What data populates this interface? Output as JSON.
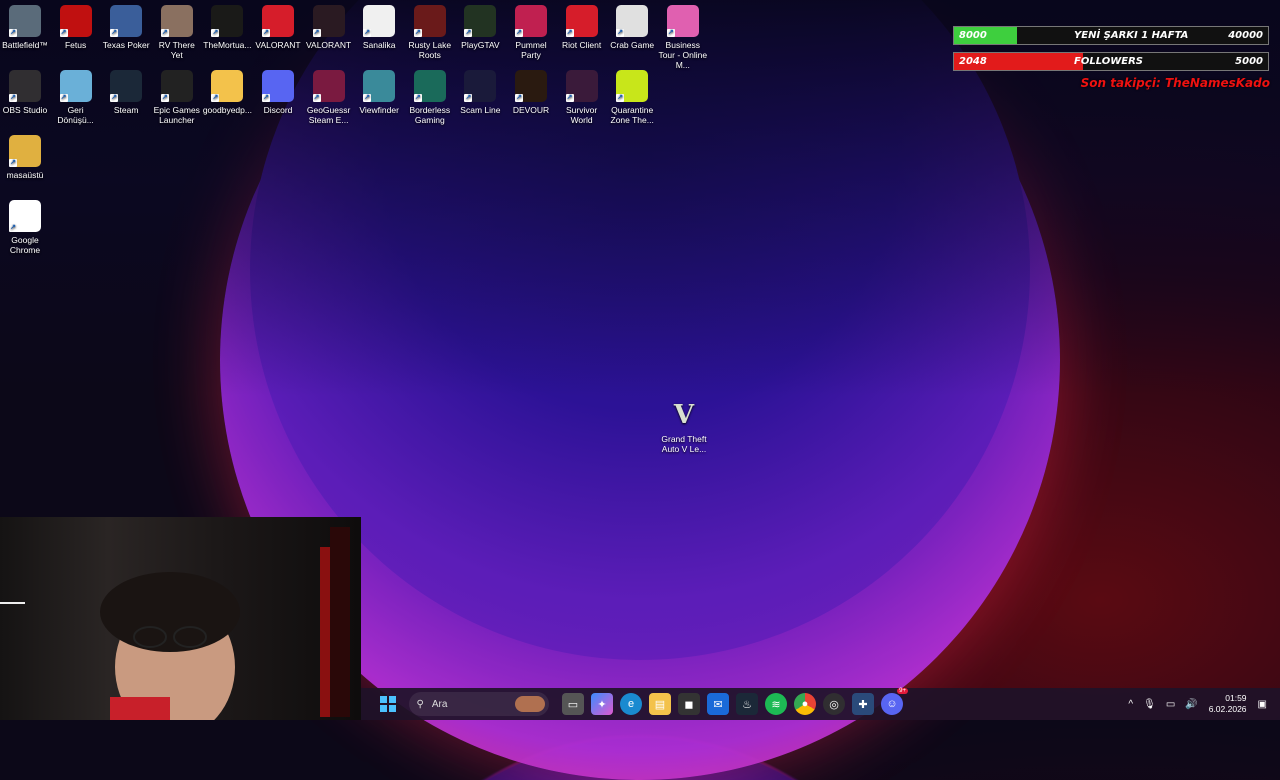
{
  "desktop_icons_row1": [
    {
      "label": "Battlefield™",
      "icon": "battlefield-icon",
      "color": "#5a6b7a"
    },
    {
      "label": "Fetus",
      "icon": "red-creature-icon",
      "color": "#c01010"
    },
    {
      "label": "Texas Poker",
      "icon": "poker-icon",
      "color": "#3a5e9a"
    },
    {
      "label": "RV There Yet",
      "icon": "rv-icon",
      "color": "#8a7060"
    },
    {
      "label": "TheMortua...",
      "icon": "mortuary-icon",
      "color": "#1a1a18"
    },
    {
      "label": "VALORANT",
      "icon": "riot-fist-icon",
      "color": "#d61d2a"
    },
    {
      "label": "VALORANT",
      "icon": "valorant-icon",
      "color": "#2a1a22"
    },
    {
      "label": "Sanalika",
      "icon": "sanalika-icon",
      "color": "#f0f0f0"
    },
    {
      "label": "Rusty Lake Roots",
      "icon": "tree-icon",
      "color": "#6a1a1a"
    },
    {
      "label": "PlayGTAV",
      "icon": "gtav-icon",
      "color": "#223322"
    },
    {
      "label": "Pummel Party",
      "icon": "pummel-party-icon",
      "color": "#c02050"
    },
    {
      "label": "Riot Client",
      "icon": "riot-fist-icon",
      "color": "#d61d2a"
    },
    {
      "label": "Crab Game",
      "icon": "crab-game-icon",
      "color": "#e0e0e0"
    },
    {
      "label": "Business Tour - Online M...",
      "icon": "business-tour-icon",
      "color": "#e060b0"
    }
  ],
  "desktop_icons_row2": [
    {
      "label": "OBS Studio",
      "icon": "obs-icon",
      "color": "#302e31"
    },
    {
      "label": "Geri Dönüşü...",
      "icon": "recycle-bin-icon",
      "color": "#6ab0d8"
    },
    {
      "label": "Steam",
      "icon": "steam-icon",
      "color": "#1b2838"
    },
    {
      "label": "Epic Games Launcher",
      "icon": "epic-games-icon",
      "color": "#222222"
    },
    {
      "label": "goodbyedp...",
      "icon": "folder-icon",
      "color": "#f3c24b"
    },
    {
      "label": "Discord",
      "icon": "discord-icon",
      "color": "#5865f2"
    },
    {
      "label": "GeoGuessr Steam E...",
      "icon": "map-pin-icon",
      "color": "#7a1a40"
    },
    {
      "label": "Viewfinder",
      "icon": "viewfinder-icon",
      "color": "#3a8a9a"
    },
    {
      "label": "Borderless Gaming",
      "icon": "borderless-gaming-icon",
      "color": "#1a6a5a"
    },
    {
      "label": "Scam Line",
      "icon": "scam-line-icon",
      "color": "#1a1a3a"
    },
    {
      "label": "DEVOUR",
      "icon": "devour-icon",
      "color": "#2a1a10"
    },
    {
      "label": "Survivor World",
      "icon": "survivor-world-icon",
      "color": "#3a1a3a"
    },
    {
      "label": "Quarantine Zone The...",
      "icon": "quarantine-zone-icon",
      "color": "#c8e61a"
    }
  ],
  "desktop_icons_col": [
    {
      "label": "masaüstü",
      "icon": "folder-icon",
      "color": "#e0b040"
    },
    {
      "label": "Google Chrome",
      "icon": "chrome-icon",
      "color": "#ffffff"
    }
  ],
  "center_icon": {
    "label": "Grand Theft Auto V Le...",
    "icon": "gtav-icon"
  },
  "overlay": {
    "goal_left": "8000",
    "goal_title": "YENİ ŞARKI 1 HAFTA",
    "goal_right": "40000",
    "goal_progress": 0.2,
    "followers_left": "2048",
    "followers_title": "FOLLOWERS",
    "followers_right": "5000",
    "followers_progress": 0.41,
    "last_follower": "Son takipçi: TheNamesKado"
  },
  "taskbar": {
    "search_placeholder": "Ara",
    "time": "01:59",
    "date": "6.02.2026",
    "discord_badge": "9+"
  }
}
